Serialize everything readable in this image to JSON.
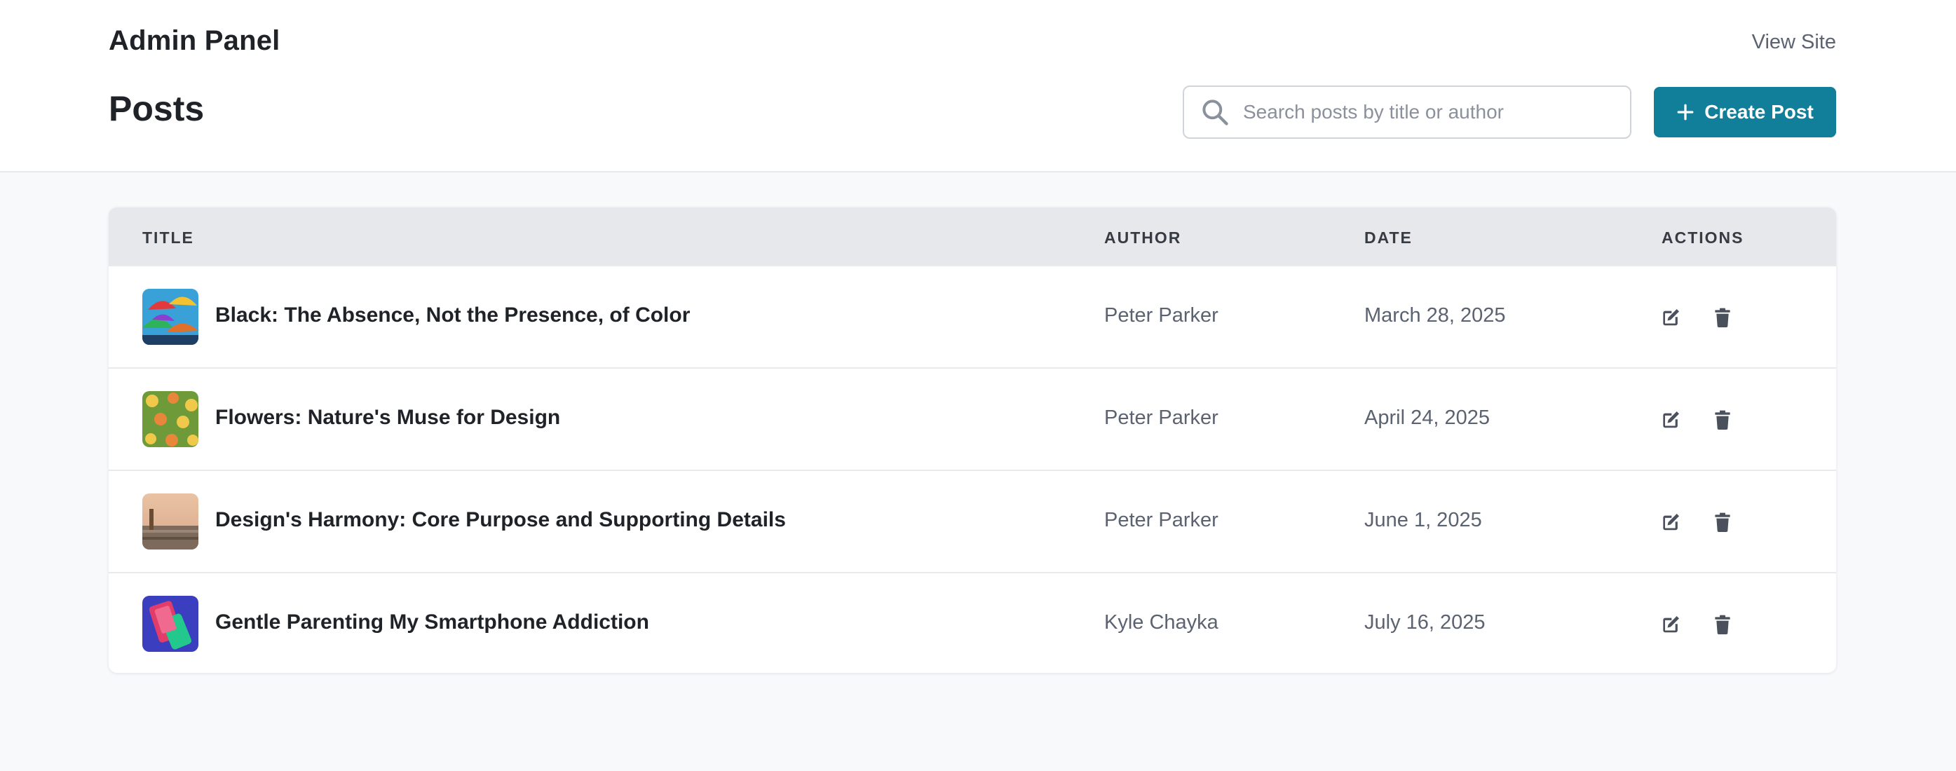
{
  "header": {
    "brand": "Admin Panel",
    "view_site": "View Site",
    "page_title": "Posts",
    "search_placeholder": "Search posts by title or author",
    "create_label": "Create Post"
  },
  "colors": {
    "accent": "#127f9a",
    "page_bg": "#f8f9fb",
    "header_row_bg": "#e6e8ec"
  },
  "table": {
    "columns": [
      "TITLE",
      "AUTHOR",
      "DATE",
      "ACTIONS"
    ],
    "rows": [
      {
        "title": "Black: The Absence, Not the Presence, of Color",
        "author": "Peter Parker",
        "date": "March 28, 2025",
        "thumb": "umbrellas-image"
      },
      {
        "title": "Flowers: Nature's Muse for Design",
        "author": "Peter Parker",
        "date": "April 24, 2025",
        "thumb": "flowers-image"
      },
      {
        "title": "Design's Harmony: Core Purpose and Supporting Details",
        "author": "Peter Parker",
        "date": "June 1, 2025",
        "thumb": "beach-image"
      },
      {
        "title": "Gentle Parenting My Smartphone Addiction",
        "author": "Kyle Chayka",
        "date": "July 16, 2025",
        "thumb": "smartphone-image"
      }
    ],
    "action_icons": [
      "edit-icon",
      "trash-icon"
    ]
  }
}
